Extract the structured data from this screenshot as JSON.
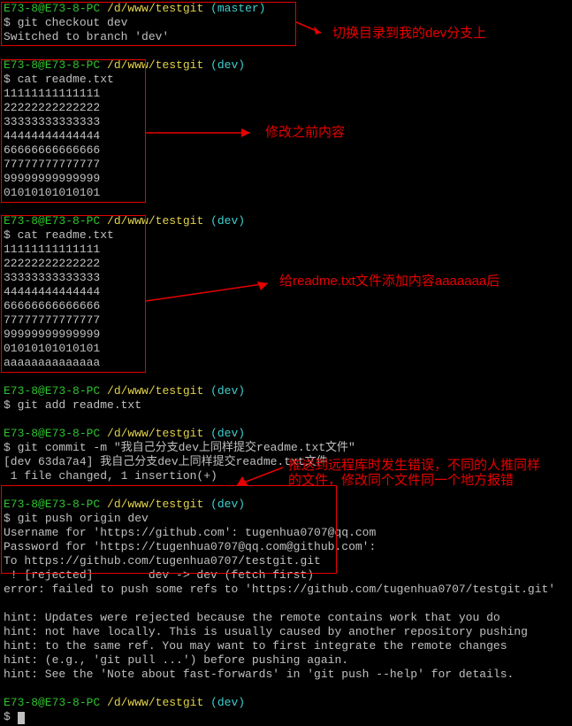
{
  "prompt": {
    "user": "E73-8@E73-8-PC",
    "path": "/d/www/testgit"
  },
  "branches": {
    "master": "(master)",
    "dev": "(dev)"
  },
  "cmds": {
    "checkout": "git checkout dev",
    "cat": "cat readme.txt",
    "add": "git add readme.txt",
    "commit": "git commit -m \"我自己分支dev上同样提交readme.txt文件\"",
    "push": "git push origin dev",
    "blankdollar": "$ "
  },
  "out": {
    "switched": "Switched to branch 'dev'",
    "l1": "11111111111111",
    "l2": "22222222222222",
    "l3": "33333333333333",
    "l4": "44444444444444",
    "l5": "66666666666666",
    "l6": "77777777777777",
    "l7": "99999999999999",
    "l8": "01010101010101",
    "l9": "aaaaaaaaaaaaaa",
    "commit1": "[dev 63da7a4] 我自己分支dev上同样提交readme.txt文件",
    "commit2": " 1 file changed, 1 insertion(+)",
    "pushUser": "Username for 'https://github.com': tugenhua0707@qq.com",
    "pushPass": "Password for 'https://tugenhua0707@qq.com@github.com':",
    "pushTo": "To https://github.com/tugenhua0707/testgit.git",
    "rejected": " ! [rejected]        dev -> dev (fetch first)",
    "error": "error: failed to push some refs to 'https://github.com/tugenhua0707/testgit.git'",
    "hint1": "hint: Updates were rejected because the remote contains work that you do",
    "hint2": "hint: not have locally. This is usually caused by another repository pushing",
    "hint3": "hint: to the same ref. You may want to first integrate the remote changes",
    "hint4": "hint: (e.g., 'git pull ...') before pushing again.",
    "hint5": "hint: See the 'Note about fast-forwards' in 'git push --help' for details."
  },
  "anno": {
    "a1": "切换目录到我的dev分支上",
    "a2": "修改之前内容",
    "a3": "给readme.txt文件添加内容aaaaaaa后",
    "a4l1": "推送到远程库时发生错误，不同的人推同样",
    "a4l2": "的文件，修改同个文件同一个地方报错"
  }
}
